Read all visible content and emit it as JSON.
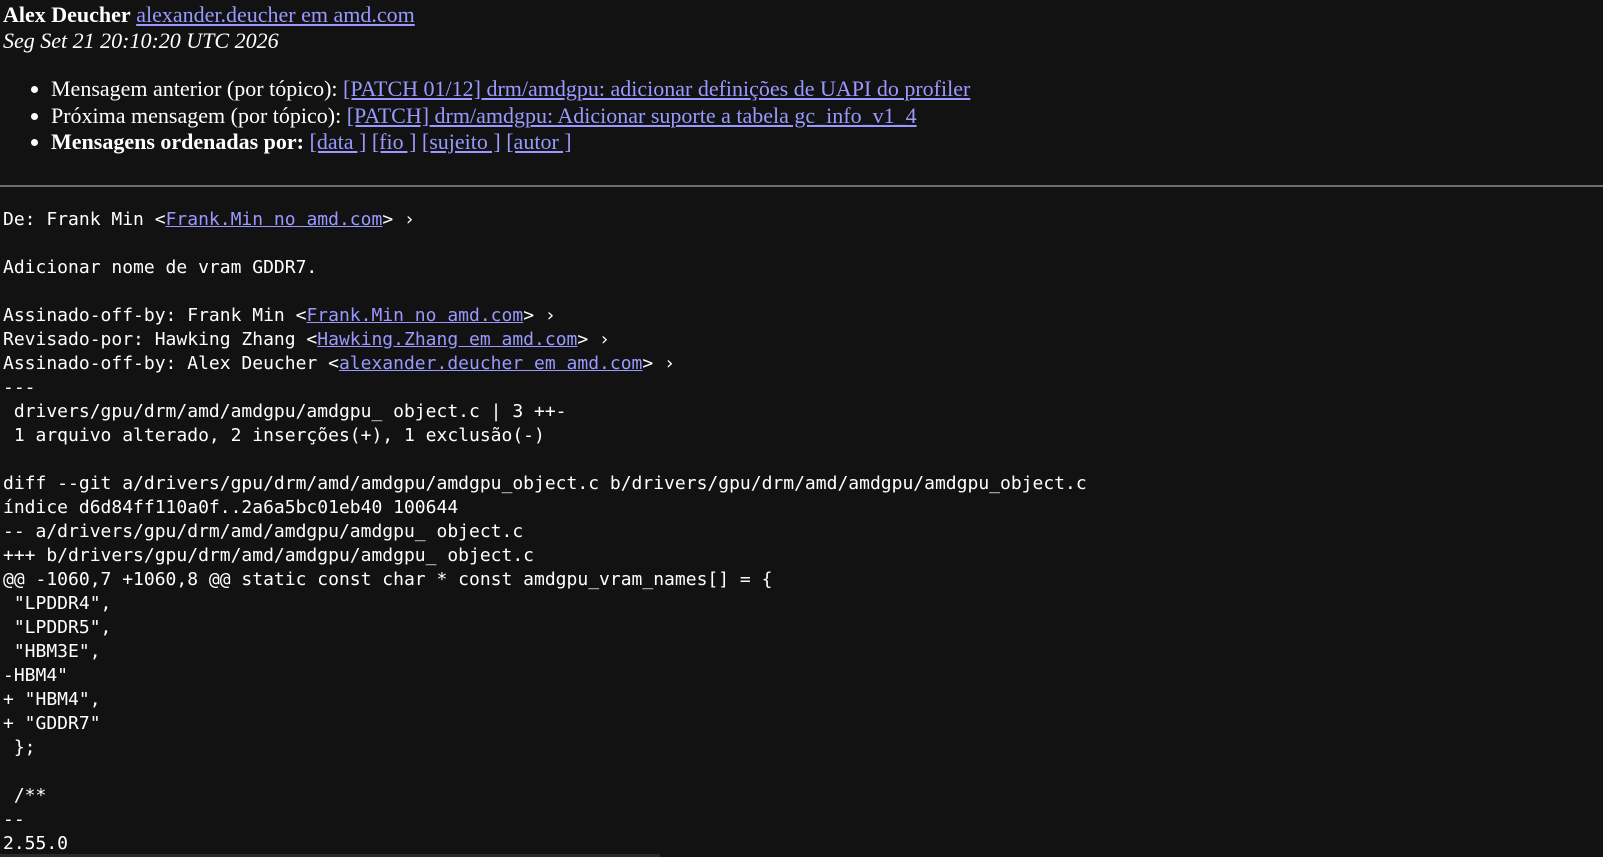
{
  "header": {
    "author_name": "Alex Deucher",
    "author_email": "alexander.deucher em amd.com",
    "date": "Seg Set 21 20:10:20 UTC 2026"
  },
  "nav": {
    "prev_label": "Mensagem anterior (por tópico):",
    "prev_link": "[PATCH 01/12] drm/amdgpu: adicionar definições de UAPI do profiler",
    "next_label": "Próxima mensagem (por tópico):",
    "next_link": "[PATCH] drm/amdgpu: Adicionar suporte a tabela gc_info_v1_4",
    "sort_label": "Mensagens ordenadas por:",
    "sort_links": [
      "[data ]",
      "[fio ]",
      "[sujeito ]",
      "[autor ]"
    ]
  },
  "body": {
    "from_prefix": "De: Frank Min <",
    "from_email": "Frank.Min no amd.com",
    "from_suffix": "> ›",
    "description": "Adicionar nome de vram GDDR7.",
    "signoff1_prefix": "Assinado-off-by: Frank Min <",
    "signoff1_email": "Frank.Min no amd.com",
    "signoff1_suffix": "> ›",
    "review_prefix": "Revisado-por: Hawking Zhang <",
    "review_email": "Hawking.Zhang em amd.com",
    "review_suffix": "> ›",
    "signoff2_prefix": "Assinado-off-by: Alex Deucher <",
    "signoff2_email": "alexander.deucher em amd.com",
    "signoff2_suffix": "> ›",
    "diff_lines": [
      "---",
      " drivers/gpu/drm/amd/amdgpu/amdgpu_ object.c | 3 ++-",
      " 1 arquivo alterado, 2 inserções(+), 1 exclusão(-)",
      "",
      "diff --git a/drivers/gpu/drm/amd/amdgpu/amdgpu_object.c b/drivers/gpu/drm/amd/amdgpu/amdgpu_object.c",
      "índice d6d84ff110a0f..2a6a5bc01eb40 100644",
      "-- a/drivers/gpu/drm/amd/amdgpu/amdgpu_ object.c",
      "+++ b/drivers/gpu/drm/amd/amdgpu/amdgpu_ object.c",
      "@@ -1060,7 +1060,8 @@ static const char * const amdgpu_vram_names[] = {",
      " \"LPDDR4\",",
      " \"LPDDR5\",",
      " \"HBM3E\",",
      "-HBM4\"",
      "+ \"HBM4\",",
      "+ \"GDDR7\"",
      " };",
      "",
      " /**",
      "--",
      "2.55.0"
    ]
  }
}
